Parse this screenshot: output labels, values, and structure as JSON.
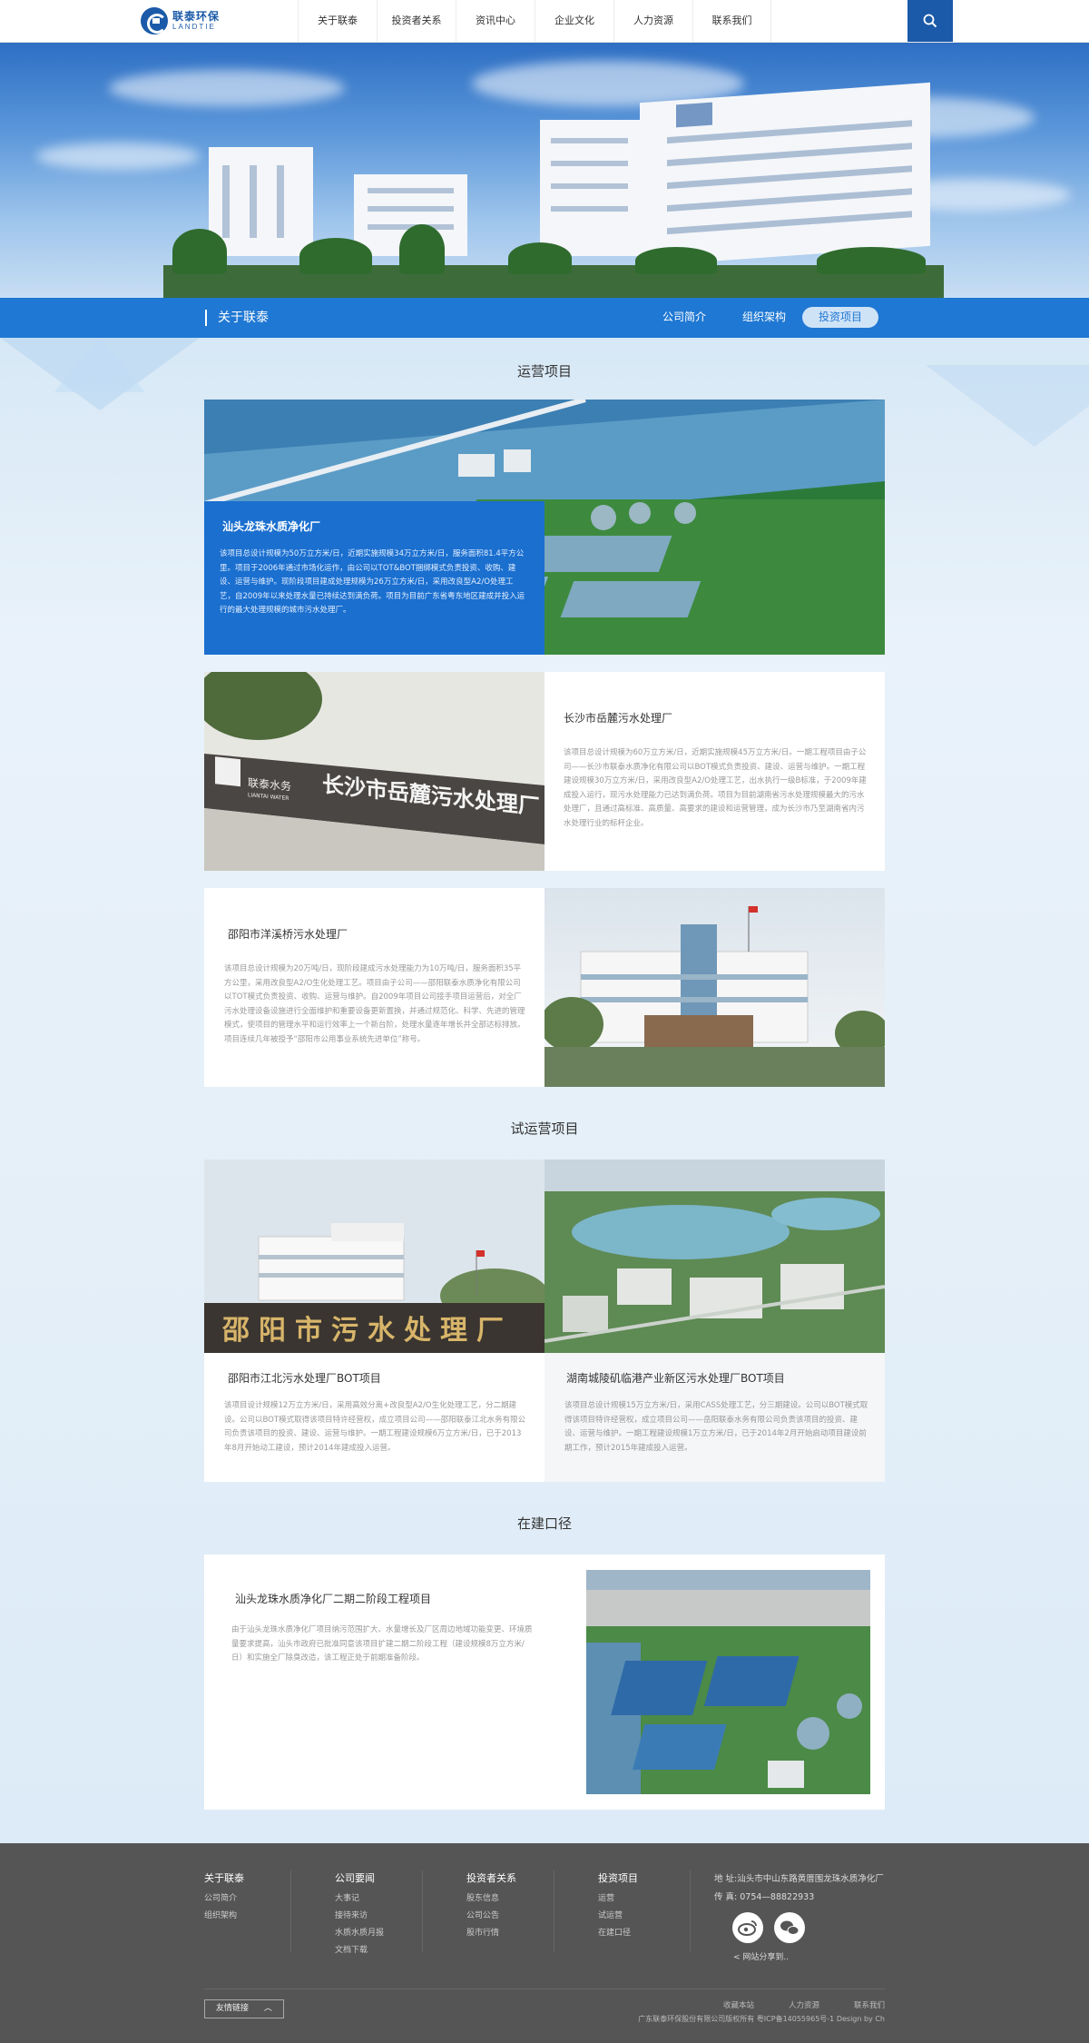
{
  "header": {
    "logo_cn": "联泰环保",
    "logo_en": "LANDTIE",
    "nav": [
      "关于联泰",
      "投资者关系",
      "资讯中心",
      "企业文化",
      "人力资源",
      "联系我们"
    ]
  },
  "subbar": {
    "title": "关于联泰",
    "tabs": [
      "公司简介",
      "组织架构",
      "投资项目"
    ],
    "active_tab": "投资项目"
  },
  "sections": {
    "operating": "运营项目",
    "trial": "试运营项目",
    "construction": "在建口径"
  },
  "projects": {
    "p1": {
      "title": "汕头龙珠水质净化厂",
      "desc": "该项目总设计规模为50万立方米/日，近期实施规模34万立方米/日，服务面积81.4平方公里。项目于2006年通过市场化运作，由公司以TOT&BOT捆绑模式负责投资、收购、建设、运营与维护。现阶段项目建成处理规模为26万立方米/日，采用改良型A2/O处理工艺，自2009年以来处理水量已持续达到满负荷。项目为目前广东省粤东地区建成并投入运行的最大处理规模的城市污水处理厂。"
    },
    "p2": {
      "title": "长沙市岳麓污水处理厂",
      "desc": "该项目总设计规模为60万立方米/日，近期实施规模45万立方米/日。一期工程项目由子公司——长沙市联泰水质净化有限公司以BOT模式负责投资、建设、运营与维护。一期工程建设规模30万立方米/日，采用改良型A2/O处理工艺，出水执行一级B标准，于2009年建成投入运行，现污水处理能力已达到满负荷。项目为目前湖南省污水处理规模最大的污水处理厂，且通过高标准、高质量、高要求的建设和运营管理，成为长沙市乃至湖南省内污水处理行业的标杆企业。",
      "sign": "长沙市岳麓污水处理厂",
      "sign_logo_cn": "联泰水务",
      "sign_logo_en": "LIANTAI WATER"
    },
    "p3": {
      "title": "邵阳市洋溪桥污水处理厂",
      "desc": "该项目总设计规模为20万吨/日，现阶段建成污水处理能力为10万吨/日，服务面积35平方公里，采用改良型A2/O生化处理工艺。项目由子公司——邵阳联泰水质净化有限公司以TOT模式负责投资、收购、运营与维护。自2009年项目公司接手项目运营后，对全厂污水处理设备设施进行全面维护和重要设备更新置换，并通过规范化、科学、先进的管理模式，使项目的管理水平和运行效率上一个新台阶，处理水量逐年增长并全部达标排放。项目连续几年被授予“邵阳市公用事业系统先进单位”称号。"
    },
    "p4": {
      "title": "邵阳市江北污水处理厂BOT项目",
      "desc": "该项目设计规模12万立方米/日，采用高效分离+改良型A2/O生化处理工艺，分二期建设。公司以BOT模式取得该项目特许经营权，成立项目公司——邵阳联泰江北水务有限公司负责该项目的投资、建设、运营与维护。一期工程建设规模6万立方米/日，已于2013年8月开始动工建设，预计2014年建成投入运营。",
      "sign": "邵阳市污水处理厂"
    },
    "p5": {
      "title": "湖南城陵矶临港产业新区污水处理厂BOT项目",
      "desc": "该项目总设计规模15万立方米/日，采用CASS处理工艺，分三期建设。公司以BOT模式取得该项目特许经营权，成立项目公司——岳阳联泰水务有限公司负责该项目的投资、建设、运营与维护。一期工程建设规模1万立方米/日，已于2014年2月开始启动项目建设前期工作，预计2015年建成投入运营。"
    },
    "p6": {
      "title": "汕头龙珠水质净化厂二期二阶段工程项目",
      "desc": "由于汕头龙珠水质净化厂项目纳污范围扩大、水量增长及厂区周边地域功能变更、环境质量要求提高，汕头市政府已批准同意该项目扩建二期二阶段工程（建设规模8万立方米/日）和实施全厂除臭改造，该工程正处于前期准备阶段。"
    }
  },
  "footer": {
    "cols": [
      {
        "title": "关于联泰",
        "links": [
          "公司简介",
          "组织架构"
        ]
      },
      {
        "title": "公司要闻",
        "links": [
          "大事记",
          "接待来访",
          "水质水质月报",
          "文档下载"
        ]
      },
      {
        "title": "投资者关系",
        "links": [
          "股东信息",
          "公司公告",
          "股市行情"
        ]
      },
      {
        "title": "投资项目",
        "links": [
          "运营",
          "试运营",
          "在建口径"
        ]
      }
    ],
    "address": "地 址:汕头市中山东路黄厝围龙珠水质净化厂",
    "fax": "传 真: 0754—88822933",
    "share": "网站分享到..",
    "friend_links": "友情链接",
    "bottom_links": [
      "收藏本站",
      "人力资源",
      "联系我们"
    ],
    "copyright": "广东联泰环保股份有限公司版权所有  粤ICP备14055965号-1  Design by Ch"
  }
}
